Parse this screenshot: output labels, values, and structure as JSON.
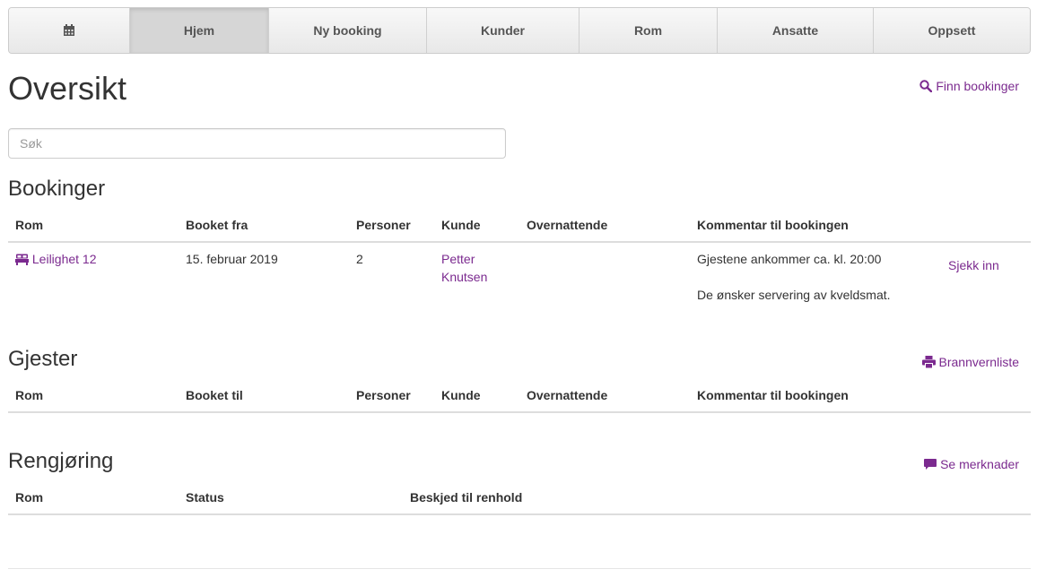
{
  "nav": {
    "items": [
      {
        "icon": "calendar-icon",
        "label": ""
      },
      {
        "label": "Hjem",
        "active": true
      },
      {
        "label": "Ny booking"
      },
      {
        "label": "Kunder"
      },
      {
        "label": "Rom"
      },
      {
        "label": "Ansatte"
      },
      {
        "label": "Oppsett"
      }
    ]
  },
  "page": {
    "title": "Oversikt",
    "find_bookings": "Finn bookinger",
    "search_placeholder": "Søk"
  },
  "bookings": {
    "title": "Bookinger",
    "headers": [
      "Rom",
      "Booket fra",
      "Personer",
      "Kunde",
      "Overnattende",
      "Kommentar til bookingen"
    ],
    "rows": [
      {
        "room": "Leilighet 12",
        "booked_from": "15. februar 2019",
        "persons": "2",
        "customer": "Petter Knutsen",
        "overnight": "",
        "comment_lines": [
          "Gjestene ankommer ca. kl. 20:00",
          "De ønsker servering av kveldsmat."
        ],
        "action": "Sjekk inn"
      }
    ]
  },
  "guests": {
    "title": "Gjester",
    "fire_list": "Brannvernliste",
    "headers": [
      "Rom",
      "Booket til",
      "Personer",
      "Kunde",
      "Overnattende",
      "Kommentar til bookingen"
    ]
  },
  "cleaning": {
    "title": "Rengjøring",
    "see_notes": "Se merknader",
    "headers": [
      "Rom",
      "Status",
      "Beskjed til renhold"
    ]
  },
  "colors": {
    "link": "#7b2a8f",
    "text": "#333333"
  }
}
